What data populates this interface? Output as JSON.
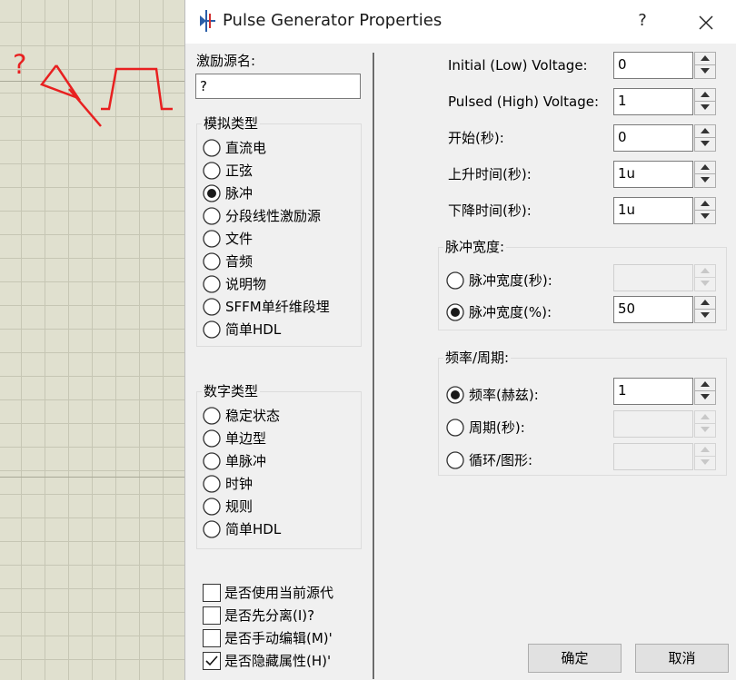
{
  "window": {
    "title": "Pulse Generator Properties",
    "help": "?",
    "icon": "pulse-generator-icon"
  },
  "background": {
    "marker": "?"
  },
  "source_name": {
    "label": "激励源名:",
    "value": "?"
  },
  "analog": {
    "title": "模拟类型",
    "selected": "脉冲",
    "options": [
      "直流电",
      "正弦",
      "脉冲",
      "分段线性激励源",
      "文件",
      "音频",
      "说明物",
      "SFFM单纤维段埋",
      "简单HDL"
    ]
  },
  "digital": {
    "title": "数字类型",
    "options": [
      "稳定状态",
      "单边型",
      "单脉冲",
      "时钟",
      "规则",
      "简单HDL"
    ]
  },
  "checkboxes": [
    {
      "label": "是否使用当前源代",
      "checked": false
    },
    {
      "label": "是否先分离(I)?",
      "checked": false
    },
    {
      "label": "是否手动编辑(M)'",
      "checked": false
    },
    {
      "label": "是否隐藏属性(H)'",
      "checked": true
    }
  ],
  "fields": [
    {
      "label": "Initial (Low) Voltage:",
      "value": "0"
    },
    {
      "label": "Pulsed (High) Voltage:",
      "value": "1"
    },
    {
      "label": "开始(秒):",
      "value": "0"
    },
    {
      "label": "上升时间(秒):",
      "value": "1u"
    },
    {
      "label": "下降时间(秒):",
      "value": "1u"
    }
  ],
  "pulse_width": {
    "title": "脉冲宽度:",
    "options": [
      {
        "label": "脉冲宽度(秒):",
        "selected": false,
        "value": ""
      },
      {
        "label": "脉冲宽度(%):",
        "selected": true,
        "value": "50"
      }
    ]
  },
  "freq_period": {
    "title": "频率/周期:",
    "options": [
      {
        "label": "频率(赫兹):",
        "selected": true,
        "value": "1"
      },
      {
        "label": "周期(秒):",
        "selected": false,
        "value": ""
      },
      {
        "label": "循环/图形:",
        "selected": false,
        "value": ""
      }
    ]
  },
  "buttons": {
    "ok": "确定",
    "cancel": "取消"
  },
  "colors": {
    "schematic_red": "#e82020",
    "grid_bg": "#e0e0cf",
    "dialog_bg": "#f0f0f0"
  }
}
